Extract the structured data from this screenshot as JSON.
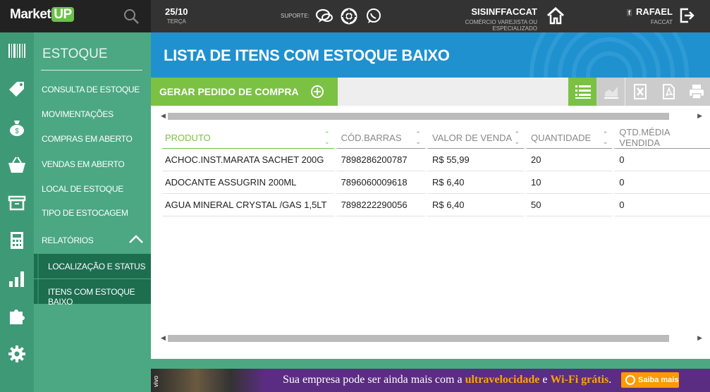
{
  "topbar": {
    "logo_text": "Market",
    "logo_badge": "UP",
    "date": "25/10",
    "weekday": "TERÇA",
    "support_label": "SUPORTE:",
    "company_name": "SISINFFACCAT",
    "company_segment": "COMÉRCIO VAREJISTA OU ESPECIALIZADO",
    "user_name": "RAFAEL",
    "user_org": "FACCAT",
    "user_network": "f"
  },
  "iconbar": [
    "barcode-icon",
    "tag-icon",
    "money-bag-icon",
    "basket-icon",
    "archive-box-icon",
    "calculator-icon",
    "bar-chart-icon",
    "puzzle-icon",
    "gear-icon"
  ],
  "sidebar": {
    "title": "ESTOQUE",
    "items": [
      {
        "label": "CONSULTA DE ESTOQUE"
      },
      {
        "label": "MOVIMENTAÇÕES"
      },
      {
        "label": "COMPRAS EM ABERTO"
      },
      {
        "label": "VENDAS EM ABERTO"
      },
      {
        "label": "LOCAL DE ESTOQUE"
      },
      {
        "label": "TIPO DE ESTOCAGEM"
      },
      {
        "label": "RELATÓRIOS"
      }
    ],
    "subitems": [
      {
        "label": "LOCALIZAÇÃO E STATUS"
      },
      {
        "label": "ITENS COM ESTOQUE BAIXO"
      }
    ]
  },
  "page": {
    "title": "LISTA DE ITENS COM ESTOQUE BAIXO",
    "generate_button": "GERAR PEDIDO DE COMPRA"
  },
  "toolbar_icons": [
    "list-view-icon",
    "chart-view-icon",
    "excel-export-icon",
    "pdf-export-icon",
    "print-icon"
  ],
  "table": {
    "headers": [
      "PRODUTO",
      "CÓD.BARRAS",
      "VALOR DE VENDA",
      "QUANTIDADE",
      "QTD.MÉDIA VENDIDA"
    ],
    "rows": [
      [
        "ACHOC.INST.MARATA SACHET 200G",
        "7898286200787",
        "R$ 55,99",
        "20",
        "0"
      ],
      [
        "ADOCANTE ASSUGRIN 200ML",
        "7896060009618",
        "R$ 6,40",
        "10",
        "0"
      ],
      [
        "AGUA MINERAL CRYSTAL /GAS 1,5LT",
        "7898222290056",
        "R$ 6,40",
        "50",
        "0"
      ]
    ]
  },
  "banner": {
    "brand": "vivo",
    "text_a": "Sua empresa pode ser ainda mais com a ",
    "highlight_a": "ultravelocidade",
    "text_b": " e ",
    "highlight_b": "Wi-Fi grátis",
    "text_c": ".",
    "cta": "Saiba mais"
  },
  "colors": {
    "accent_green": "#7bc143",
    "header_blue": "#1f91cf",
    "sidebar_green": "#4ba882",
    "banner_purple": "#5b2d82"
  }
}
